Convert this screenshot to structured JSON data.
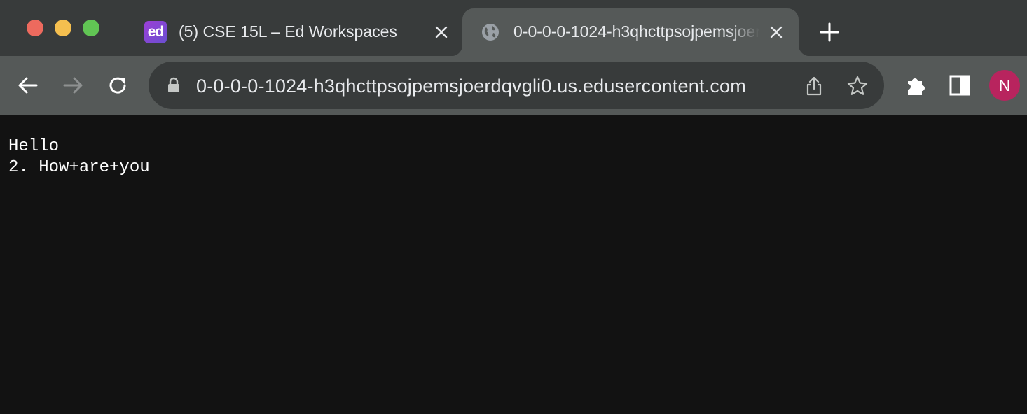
{
  "window": {
    "traffic_lights": [
      "close",
      "minimize",
      "maximize"
    ]
  },
  "tabs": [
    {
      "title": "(5) CSE 15L – Ed Workspaces",
      "favicon": "ed",
      "active": false
    },
    {
      "title": "0-0-0-0-1024-h3qhcttpsojpemsjoerdqvgli0.us.edusercontent.com",
      "favicon": "globe-icon",
      "active": true
    }
  ],
  "toolbar": {
    "url": "0-0-0-0-1024-h3qhcttpsojpemsjoerdqvgli0.us.edusercontent.com",
    "avatar_initial": "N",
    "avatar_color": "#b8245e"
  },
  "page": {
    "lines": [
      "Hello",
      "2. How+are+you"
    ]
  },
  "colors": {
    "tab_strip": "#383b3b",
    "toolbar": "#555958",
    "content_bg": "#121212",
    "text": "#e8eaed"
  }
}
